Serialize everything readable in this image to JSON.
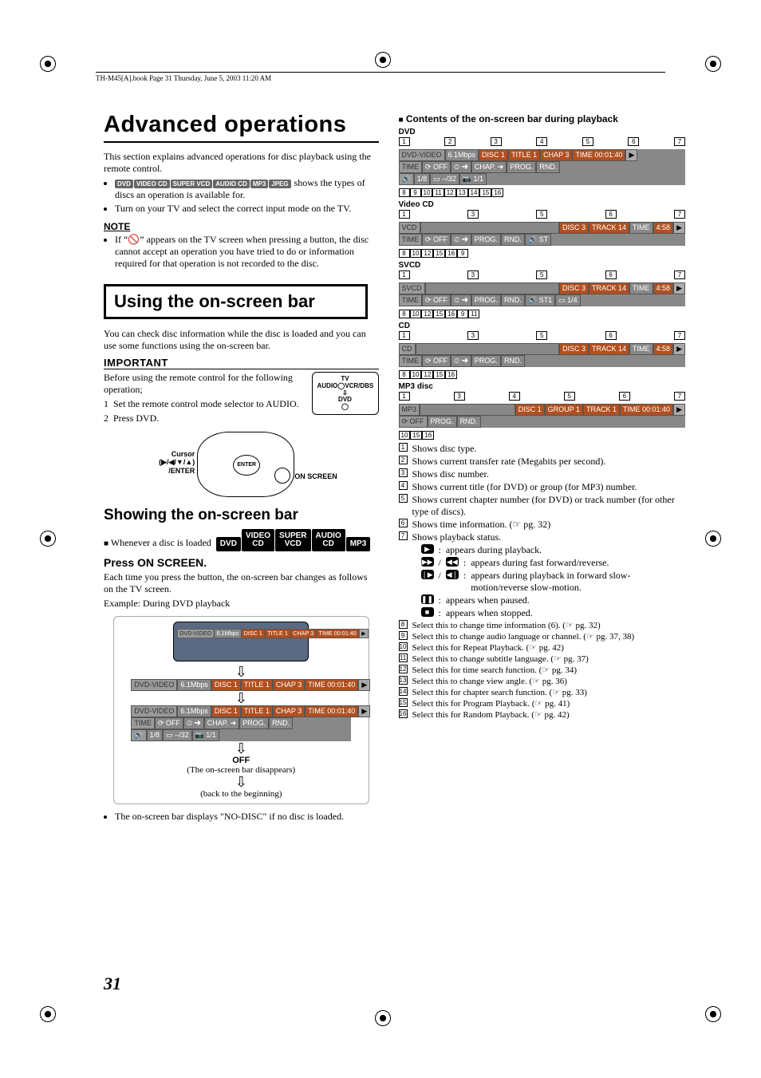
{
  "header_line": "TH-M45[A].book  Page 31  Thursday, June 5, 2003  11:20 AM",
  "page_number": "31",
  "page_title": "Advanced operations",
  "intro": "This section explains advanced operations for disc playback using the remote control.",
  "badges_small": [
    "DVD",
    "VIDEO CD",
    "SUPER VCD",
    "AUDIO CD",
    "MP3",
    "JPEG"
  ],
  "intro_b1_tail": " shows the types of discs an operation is available for.",
  "intro_b2": "Turn on your TV and select the correct input mode on the TV.",
  "note_head": "NOTE",
  "note_text": "If “🚫” appears on the TV screen when pressing a button, the disc cannot accept an operation you have tried to do or information required for that operation is not recorded to the disc.",
  "box_title": "Using the on-screen bar",
  "box_intro": "You can check disc information while the disc is loaded and you can use some functions using the on-screen bar.",
  "important_head": "IMPORTANT",
  "important_pre": "Before using the remote control for the following operation;",
  "important_steps": [
    "Set the remote control mode selector to AUDIO.",
    "Press DVD."
  ],
  "selector": {
    "top": "TV",
    "left": "AUDIO",
    "right": "VCR/DBS",
    "arrow": "⇩",
    "bottom": "DVD"
  },
  "remote": {
    "cursor_label": "Cursor",
    "cursor_keys": "(▶/◀/▼/▲) /ENTER",
    "enter": "ENTER",
    "on_screen": "ON SCREEN",
    "on_small": "ON SCREEN"
  },
  "showing_head": "Showing the on-screen bar",
  "whenever": "Whenever a disc is loaded",
  "badges_big": [
    "DVD",
    "VIDEO CD",
    "SUPER VCD",
    "AUDIO CD",
    "MP3"
  ],
  "press_head": "Press ON SCREEN.",
  "press_body": "Each time you press the button, the on-screen bar changes as follows on the TV screen.",
  "example_label": "Example: During DVD playback",
  "stage": {
    "off_label": "OFF",
    "off_text": "(The on-screen bar disappears)",
    "back_text": "(back to the beginning)"
  },
  "no_disc": "The on-screen bar displays \"NO-DISC\" if no disc is loaded.",
  "right_head": "Contents of the on-screen bar during playback",
  "sections": {
    "dvd": {
      "label": "DVD",
      "top_callouts": [
        "1",
        "2",
        "3",
        "4",
        "5",
        "6",
        "7"
      ],
      "row1": [
        "DVD-VIDEO",
        "6.1Mbps",
        "DISC 1",
        "TITLE  1",
        "CHAP  3",
        "TIME 00:01:40",
        "▶"
      ],
      "row2": [
        "TIME",
        "⟳ OFF",
        "⏲ ➜",
        "CHAP. ➜",
        "PROG.",
        "RND."
      ],
      "row3": [
        "🔊",
        "1/8",
        "▭ –/32",
        "📷 1/1"
      ],
      "bottom_callouts": [
        "8",
        "9",
        "10",
        "11",
        "12",
        "13",
        "14",
        "15",
        "16"
      ]
    },
    "vcd": {
      "label": "Video CD",
      "top_callouts": [
        "1",
        "3",
        "5",
        "6",
        "7"
      ],
      "row1": [
        "VCD",
        "",
        "DISC 3",
        "TRACK 14",
        "TIME",
        "4:58",
        "▶"
      ],
      "row2": [
        "TIME",
        "⟳ OFF",
        "⏲ ➜",
        "PROG.",
        "RND.",
        "🔊 ST"
      ],
      "bottom_callouts": [
        "8",
        "10",
        "12",
        "15",
        "16",
        "9"
      ]
    },
    "svcd": {
      "label": "SVCD",
      "top_callouts": [
        "1",
        "3",
        "5",
        "6",
        "7"
      ],
      "row1": [
        "SVCD",
        "",
        "DISC 3",
        "TRACK 14",
        "TIME",
        "4:58",
        "▶"
      ],
      "row2": [
        "TIME",
        "⟳ OFF",
        "⏲ ➜",
        "PROG.",
        "RND.",
        "🔊 ST1",
        "▭  1/4"
      ],
      "bottom_callouts": [
        "8",
        "10",
        "12",
        "15",
        "16",
        "9",
        "11"
      ]
    },
    "cd": {
      "label": "CD",
      "top_callouts": [
        "1",
        "3",
        "5",
        "6",
        "7"
      ],
      "row1": [
        "CD",
        "",
        "DISC 3",
        "TRACK 14",
        "TIME",
        "4:58",
        "▶"
      ],
      "row2": [
        "TIME",
        "⟳ OFF",
        "⏲ ➜",
        "PROG.",
        "RND."
      ],
      "bottom_callouts": [
        "8",
        "10",
        "12",
        "15",
        "16"
      ]
    },
    "mp3": {
      "label": "MP3 disc",
      "top_callouts": [
        "1",
        "3",
        "4",
        "5",
        "6",
        "7"
      ],
      "row1": [
        "MP3",
        "",
        "DISC 1",
        "GROUP  1",
        "TRACK  1",
        "TIME 00:01:40",
        "▶"
      ],
      "row2": [
        "⟳ OFF",
        "PROG.",
        "RND."
      ],
      "bottom_callouts": [
        "10",
        "15",
        "16"
      ]
    }
  },
  "legend": [
    {
      "n": "1",
      "t": "Shows disc type."
    },
    {
      "n": "2",
      "t": "Shows current transfer rate (Megabits per second)."
    },
    {
      "n": "3",
      "t": "Shows disc number."
    },
    {
      "n": "4",
      "t": "Shows current title (for DVD) or group (for MP3) number."
    },
    {
      "n": "5",
      "t": "Shows current chapter number (for DVD) or track number (for other type of discs)."
    },
    {
      "n": "6",
      "t": "Shows time information. (☞ pg. 32)"
    },
    {
      "n": "7",
      "t": "Shows playback status."
    }
  ],
  "status_icons": [
    {
      "icon": "▶",
      "sep": ":",
      "t": "appears during playback."
    },
    {
      "icon": "▶▶ / ◀◀",
      "sep": ":",
      "t": "appears during fast forward/reverse."
    },
    {
      "icon": "❘▶ / ◀❘",
      "sep": ":",
      "t": "appears during playback in forward slow-motion/reverse slow-motion."
    },
    {
      "icon": "❚❚",
      "sep": ":",
      "t": "appears when paused."
    },
    {
      "icon": "■",
      "sep": ":",
      "t": "appears when stopped."
    }
  ],
  "legend2": [
    {
      "n": "8",
      "t": "Select this to change time information (6). (☞ pg. 32)"
    },
    {
      "n": "9",
      "t": "Select this to change audio language or channel. (☞ pg. 37, 38)"
    },
    {
      "n": "10",
      "t": "Select this for Repeat Playback. (☞ pg. 42)"
    },
    {
      "n": "11",
      "t": "Select this to change subtitle language. (☞ pg. 37)"
    },
    {
      "n": "12",
      "t": "Select this for time search function. (☞ pg. 34)"
    },
    {
      "n": "13",
      "t": "Select this to change view angle. (☞ pg. 36)"
    },
    {
      "n": "14",
      "t": "Select this for chapter search function. (☞ pg. 33)"
    },
    {
      "n": "15",
      "t": "Select this for Program Playback. (☞ pg. 41)"
    },
    {
      "n": "16",
      "t": "Select this for Random Playback. (☞ pg. 42)"
    }
  ]
}
